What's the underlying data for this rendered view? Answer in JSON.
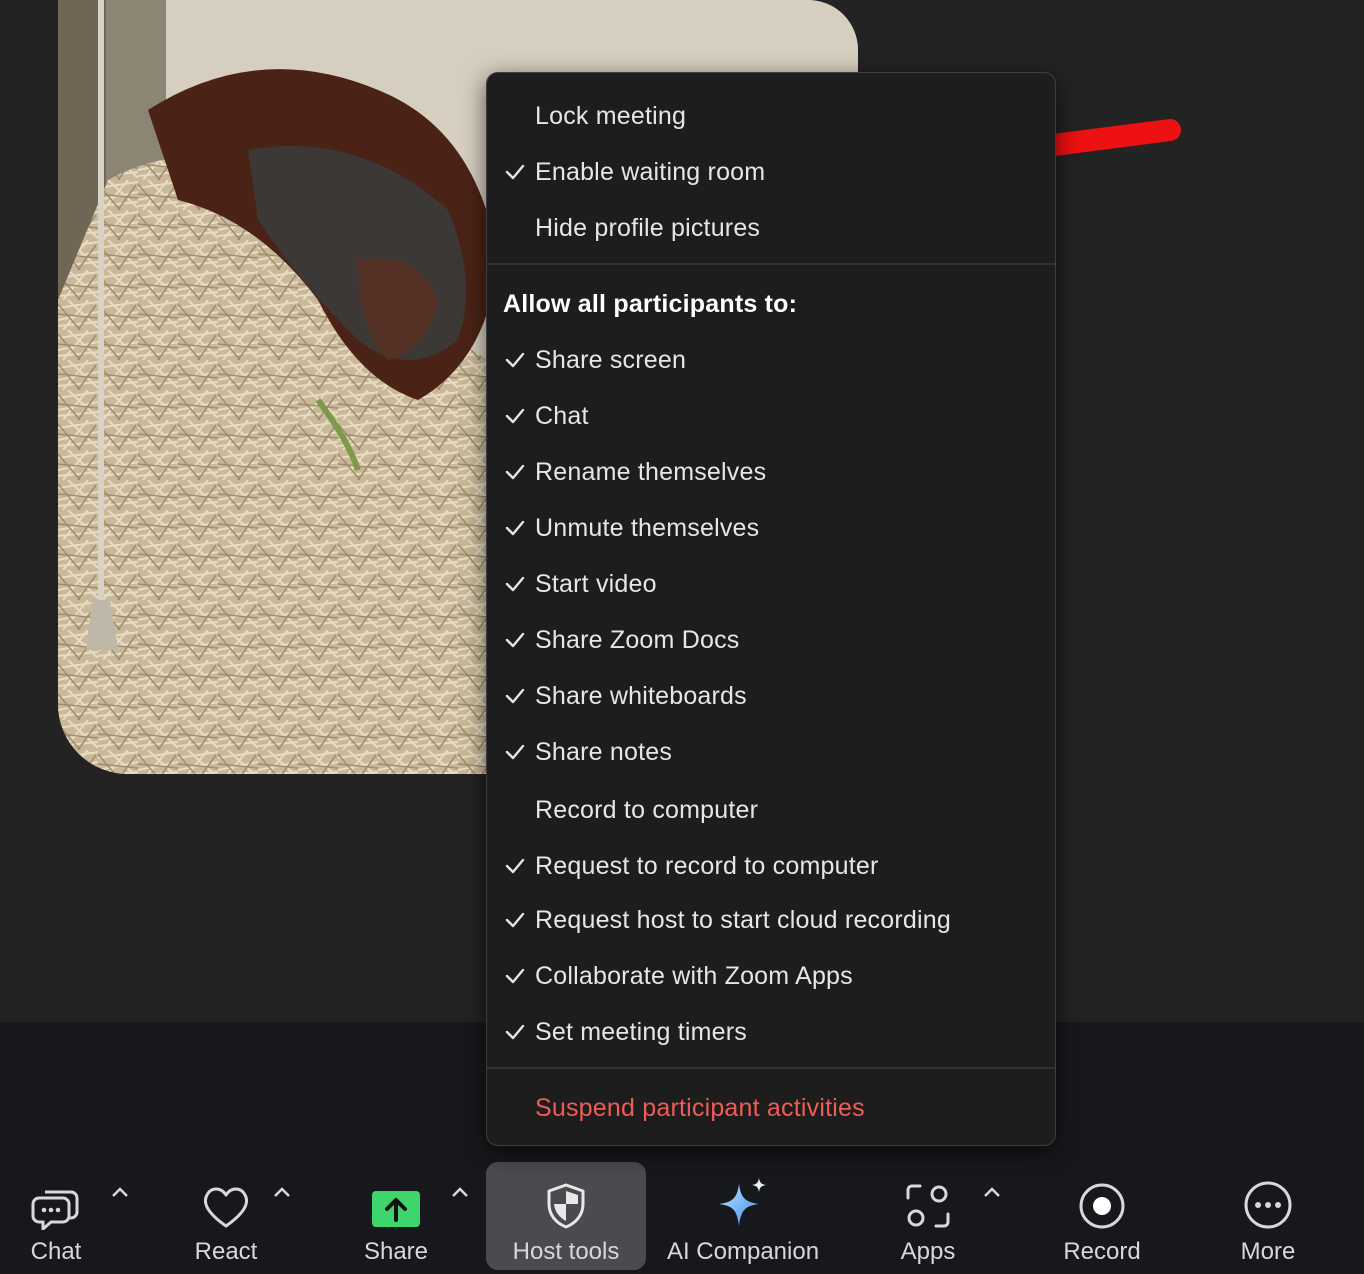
{
  "menu": {
    "top_items": [
      {
        "label": "Lock meeting",
        "checked": false
      },
      {
        "label": "Enable waiting room",
        "checked": true
      },
      {
        "label": "Hide profile pictures",
        "checked": false
      }
    ],
    "section_header": "Allow all participants to:",
    "participant_items": [
      {
        "label": "Share screen",
        "checked": true
      },
      {
        "label": "Chat",
        "checked": true
      },
      {
        "label": "Rename themselves",
        "checked": true
      },
      {
        "label": "Unmute themselves",
        "checked": true
      },
      {
        "label": "Start video",
        "checked": true
      },
      {
        "label": "Share Zoom Docs",
        "checked": true
      },
      {
        "label": "Share whiteboards",
        "checked": true
      },
      {
        "label": "Share notes",
        "checked": true
      },
      {
        "label": "Record to computer",
        "checked": false
      },
      {
        "label": "Request to record to computer",
        "checked": true
      },
      {
        "label": "Request host to start cloud recording",
        "checked": true
      },
      {
        "label": "Collaborate with Zoom Apps",
        "checked": true
      },
      {
        "label": "Set meeting timers",
        "checked": true
      }
    ],
    "danger_item": "Suspend participant activities"
  },
  "toolbar": {
    "chat": "Chat",
    "react": "React",
    "share": "Share",
    "host_tools": "Host tools",
    "ai_companion": "AI Companion",
    "apps": "Apps",
    "record": "Record",
    "more": "More"
  },
  "colors": {
    "share_green": "#3ed66c",
    "danger": "#ef5b55",
    "annotation_arrow": "#ee1111"
  }
}
